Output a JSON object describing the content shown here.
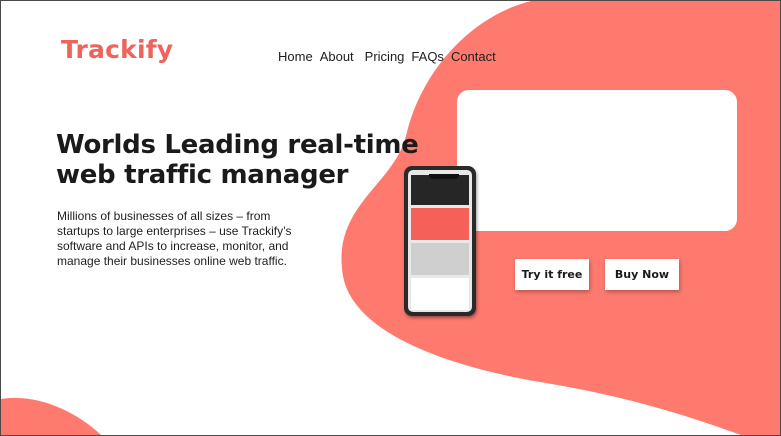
{
  "brand": {
    "name": "Trackify",
    "color": "#f0635a"
  },
  "nav": {
    "items": [
      {
        "label": "Home"
      },
      {
        "label": "About"
      },
      {
        "label": "Pricing"
      },
      {
        "label": "FAQs"
      },
      {
        "label": "Contact"
      }
    ]
  },
  "hero": {
    "headline_line1": "Worlds Leading real-time",
    "headline_line2": "web traffic manager",
    "description": "Millions of businesses of all sizes – from startups to large enterprises – use Trackify’s software and APIs to increase, monitor, and manage their businesses online web traffic."
  },
  "actions": {
    "try_label": "Try it free",
    "buy_label": "Buy Now"
  },
  "theme": {
    "accent": "#ff7a6e",
    "text": "#1a1a1a"
  },
  "phone_blocks": [
    {
      "color": "#262626"
    },
    {
      "color": "#f56158"
    },
    {
      "color": "#cfcfcf"
    },
    {
      "color": "#ffffff"
    }
  ]
}
